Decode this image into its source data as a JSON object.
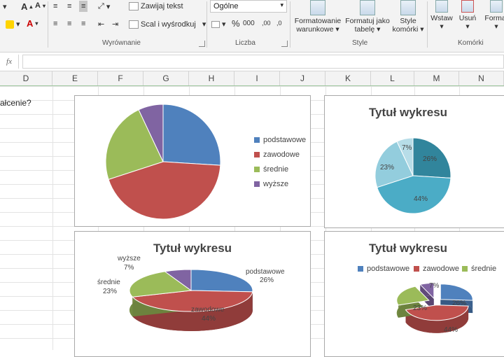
{
  "ribbon": {
    "wrap_text": "Zawijaj tekst",
    "merge_center": "Scal i wyśrodkuj",
    "number_format": "Ogólne",
    "percent": "%",
    "comma": "000",
    "inc_decimal": ",00",
    "dec_decimal": ",0",
    "cond_format": [
      "Formatowanie",
      "warunkowe"
    ],
    "format_table": [
      "Formatuj jako",
      "tabelę"
    ],
    "cell_styles": [
      "Style",
      "komórki"
    ],
    "insert": "Wstaw",
    "delete": "Usuń",
    "format": "Format",
    "groups": {
      "alignment": "Wyrównanie",
      "number": "Liczba",
      "styles": "Style",
      "cells": "Komórki"
    }
  },
  "formula_bar": {
    "fx": "fx",
    "content": ""
  },
  "columns": [
    "D",
    "E",
    "F",
    "G",
    "H",
    "I",
    "J",
    "K",
    "L",
    "M",
    "N"
  ],
  "cell_text": "ałcenie?",
  "colors": {
    "podstawowe": "#4f81bd",
    "zawodowe": "#c0504d",
    "srednie": "#9bbb59",
    "wyzsze": "#8064a2",
    "teal_dark": "#31859c",
    "teal_mid": "#4bacc6",
    "teal_light": "#93cddd",
    "teal_pale": "#b7dde8"
  },
  "chart_data": [
    {
      "type": "pie",
      "title": "",
      "categories": [
        "podstawowe",
        "zawodowe",
        "średnie",
        "wyższe"
      ],
      "values": [
        26,
        44,
        23,
        7
      ],
      "legend": "right"
    },
    {
      "type": "pie",
      "title": "Tytuł wykresu",
      "categories": [
        "podstawowe",
        "zawodowe",
        "średnie",
        "wyższe"
      ],
      "values": [
        26,
        44,
        23,
        7
      ],
      "data_labels": [
        "26%",
        "44%",
        "23%",
        "7%"
      ],
      "legend": "none"
    },
    {
      "type": "pie",
      "title": "Tytuł wykresu",
      "style": "3d",
      "categories": [
        "podstawowe",
        "zawodowe",
        "średnie",
        "wyższe"
      ],
      "values": [
        26,
        44,
        23,
        7
      ],
      "data_labels": [
        "26%",
        "44%",
        "23%",
        "7%"
      ],
      "legend": "none"
    },
    {
      "type": "pie",
      "title": "Tytuł wykresu",
      "style": "3d-exploded",
      "categories": [
        "podstawowe",
        "zawodowe",
        "średnie",
        "wyższe"
      ],
      "values": [
        26,
        44,
        23,
        7
      ],
      "data_labels": [
        "26%",
        "44%",
        "23%",
        "7%"
      ],
      "legend": "top"
    }
  ]
}
